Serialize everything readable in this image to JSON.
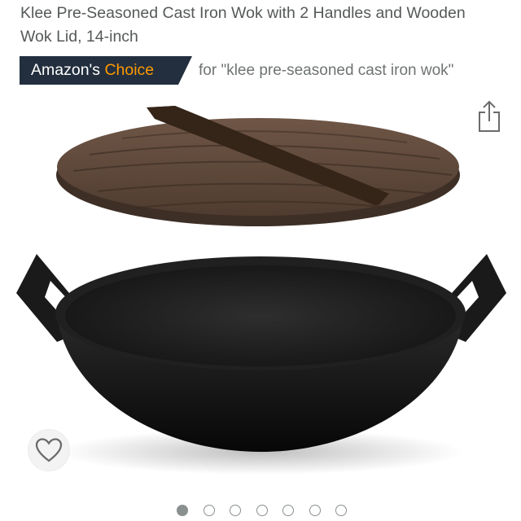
{
  "product": {
    "title": "Klee Pre-Seasoned Cast Iron Wok with 2 Handles and Wooden Wok Lid, 14-inch"
  },
  "badge": {
    "prefix": "Amazon's",
    "highlight": "Choice",
    "query_text": "for \"klee pre-seasoned cast iron wok\""
  },
  "colors": {
    "badge_bg": "#232f3e",
    "badge_accent": "#ff9900",
    "title_text": "#565959"
  },
  "icons": {
    "share": "share-icon",
    "favorite": "heart-icon"
  },
  "carousel": {
    "image_count": 7,
    "active_index": 0
  }
}
